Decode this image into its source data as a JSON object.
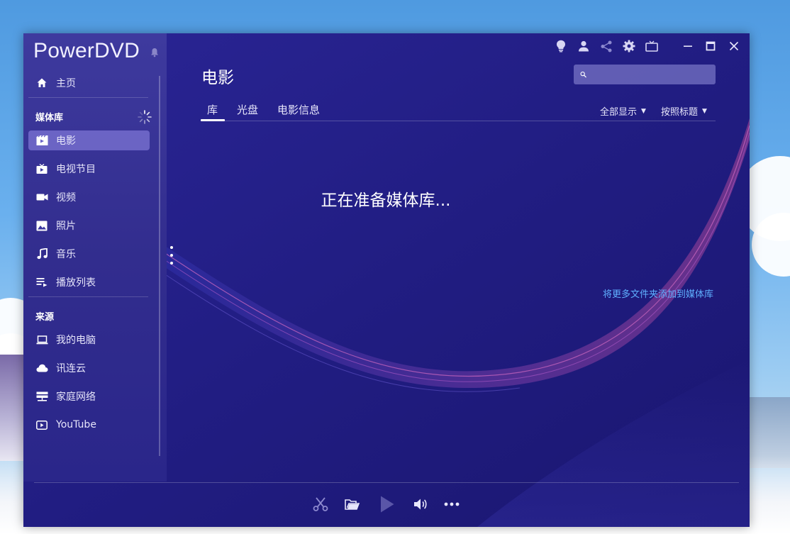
{
  "app": {
    "brand": "PowerDVD"
  },
  "header": {
    "title": "电影",
    "search": {
      "value": "",
      "placeholder": ""
    }
  },
  "sidebar": {
    "home": "主页",
    "library_heading": "媒体库",
    "library_items": [
      {
        "label": "电影",
        "icon": "movie-icon",
        "active": true
      },
      {
        "label": "电视节目",
        "icon": "tv-icon",
        "active": false
      },
      {
        "label": "视频",
        "icon": "video-camera-icon",
        "active": false
      },
      {
        "label": "照片",
        "icon": "photo-icon",
        "active": false
      },
      {
        "label": "音乐",
        "icon": "music-note-icon",
        "active": false
      },
      {
        "label": "播放列表",
        "icon": "playlist-icon",
        "active": false
      }
    ],
    "sources_heading": "来源",
    "source_items": [
      {
        "label": "我的电脑",
        "icon": "laptop-icon"
      },
      {
        "label": "讯连云",
        "icon": "cloud-icon"
      },
      {
        "label": "家庭网络",
        "icon": "network-icon"
      },
      {
        "label": "YouTube",
        "icon": "youtube-icon"
      }
    ]
  },
  "tabs": [
    {
      "label": "库",
      "active": true
    },
    {
      "label": "光盘",
      "active": false
    },
    {
      "label": "电影信息",
      "active": false
    }
  ],
  "filters": {
    "display": "全部显示",
    "sort": "按照标题"
  },
  "content": {
    "status": "正在准备媒体库...",
    "add_folders_link": "将更多文件夹添加到媒体库"
  },
  "topbar_icons": [
    "lightbulb-icon",
    "user-icon",
    "share-icon",
    "gear-icon",
    "tv-mode-icon",
    "minimize-icon",
    "maximize-icon",
    "close-icon"
  ],
  "player_icons": [
    "scissors-icon",
    "open-folder-icon",
    "play-icon",
    "volume-icon",
    "more-icon"
  ],
  "colors": {
    "window_bg": "#1f1c78",
    "sidebar_bg": "#3e3a9e",
    "active_item": "#8f86e6",
    "link": "#5fb0ff",
    "wave_accent": "#c04fb8"
  }
}
